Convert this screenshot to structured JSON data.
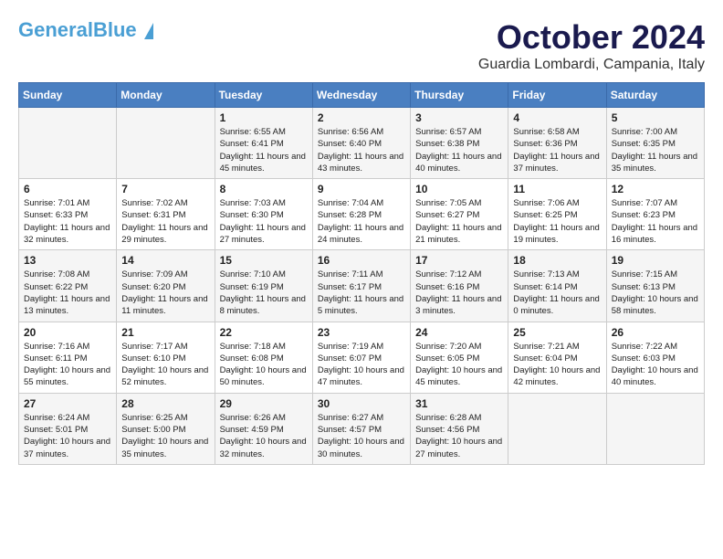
{
  "header": {
    "logo_general": "General",
    "logo_blue": "Blue",
    "month_title": "October 2024",
    "location": "Guardia Lombardi, Campania, Italy"
  },
  "weekdays": [
    "Sunday",
    "Monday",
    "Tuesday",
    "Wednesday",
    "Thursday",
    "Friday",
    "Saturday"
  ],
  "weeks": [
    [
      {
        "day": "",
        "info": ""
      },
      {
        "day": "",
        "info": ""
      },
      {
        "day": "1",
        "info": "Sunrise: 6:55 AM\nSunset: 6:41 PM\nDaylight: 11 hours and 45 minutes."
      },
      {
        "day": "2",
        "info": "Sunrise: 6:56 AM\nSunset: 6:40 PM\nDaylight: 11 hours and 43 minutes."
      },
      {
        "day": "3",
        "info": "Sunrise: 6:57 AM\nSunset: 6:38 PM\nDaylight: 11 hours and 40 minutes."
      },
      {
        "day": "4",
        "info": "Sunrise: 6:58 AM\nSunset: 6:36 PM\nDaylight: 11 hours and 37 minutes."
      },
      {
        "day": "5",
        "info": "Sunrise: 7:00 AM\nSunset: 6:35 PM\nDaylight: 11 hours and 35 minutes."
      }
    ],
    [
      {
        "day": "6",
        "info": "Sunrise: 7:01 AM\nSunset: 6:33 PM\nDaylight: 11 hours and 32 minutes."
      },
      {
        "day": "7",
        "info": "Sunrise: 7:02 AM\nSunset: 6:31 PM\nDaylight: 11 hours and 29 minutes."
      },
      {
        "day": "8",
        "info": "Sunrise: 7:03 AM\nSunset: 6:30 PM\nDaylight: 11 hours and 27 minutes."
      },
      {
        "day": "9",
        "info": "Sunrise: 7:04 AM\nSunset: 6:28 PM\nDaylight: 11 hours and 24 minutes."
      },
      {
        "day": "10",
        "info": "Sunrise: 7:05 AM\nSunset: 6:27 PM\nDaylight: 11 hours and 21 minutes."
      },
      {
        "day": "11",
        "info": "Sunrise: 7:06 AM\nSunset: 6:25 PM\nDaylight: 11 hours and 19 minutes."
      },
      {
        "day": "12",
        "info": "Sunrise: 7:07 AM\nSunset: 6:23 PM\nDaylight: 11 hours and 16 minutes."
      }
    ],
    [
      {
        "day": "13",
        "info": "Sunrise: 7:08 AM\nSunset: 6:22 PM\nDaylight: 11 hours and 13 minutes."
      },
      {
        "day": "14",
        "info": "Sunrise: 7:09 AM\nSunset: 6:20 PM\nDaylight: 11 hours and 11 minutes."
      },
      {
        "day": "15",
        "info": "Sunrise: 7:10 AM\nSunset: 6:19 PM\nDaylight: 11 hours and 8 minutes."
      },
      {
        "day": "16",
        "info": "Sunrise: 7:11 AM\nSunset: 6:17 PM\nDaylight: 11 hours and 5 minutes."
      },
      {
        "day": "17",
        "info": "Sunrise: 7:12 AM\nSunset: 6:16 PM\nDaylight: 11 hours and 3 minutes."
      },
      {
        "day": "18",
        "info": "Sunrise: 7:13 AM\nSunset: 6:14 PM\nDaylight: 11 hours and 0 minutes."
      },
      {
        "day": "19",
        "info": "Sunrise: 7:15 AM\nSunset: 6:13 PM\nDaylight: 10 hours and 58 minutes."
      }
    ],
    [
      {
        "day": "20",
        "info": "Sunrise: 7:16 AM\nSunset: 6:11 PM\nDaylight: 10 hours and 55 minutes."
      },
      {
        "day": "21",
        "info": "Sunrise: 7:17 AM\nSunset: 6:10 PM\nDaylight: 10 hours and 52 minutes."
      },
      {
        "day": "22",
        "info": "Sunrise: 7:18 AM\nSunset: 6:08 PM\nDaylight: 10 hours and 50 minutes."
      },
      {
        "day": "23",
        "info": "Sunrise: 7:19 AM\nSunset: 6:07 PM\nDaylight: 10 hours and 47 minutes."
      },
      {
        "day": "24",
        "info": "Sunrise: 7:20 AM\nSunset: 6:05 PM\nDaylight: 10 hours and 45 minutes."
      },
      {
        "day": "25",
        "info": "Sunrise: 7:21 AM\nSunset: 6:04 PM\nDaylight: 10 hours and 42 minutes."
      },
      {
        "day": "26",
        "info": "Sunrise: 7:22 AM\nSunset: 6:03 PM\nDaylight: 10 hours and 40 minutes."
      }
    ],
    [
      {
        "day": "27",
        "info": "Sunrise: 6:24 AM\nSunset: 5:01 PM\nDaylight: 10 hours and 37 minutes."
      },
      {
        "day": "28",
        "info": "Sunrise: 6:25 AM\nSunset: 5:00 PM\nDaylight: 10 hours and 35 minutes."
      },
      {
        "day": "29",
        "info": "Sunrise: 6:26 AM\nSunset: 4:59 PM\nDaylight: 10 hours and 32 minutes."
      },
      {
        "day": "30",
        "info": "Sunrise: 6:27 AM\nSunset: 4:57 PM\nDaylight: 10 hours and 30 minutes."
      },
      {
        "day": "31",
        "info": "Sunrise: 6:28 AM\nSunset: 4:56 PM\nDaylight: 10 hours and 27 minutes."
      },
      {
        "day": "",
        "info": ""
      },
      {
        "day": "",
        "info": ""
      }
    ]
  ]
}
